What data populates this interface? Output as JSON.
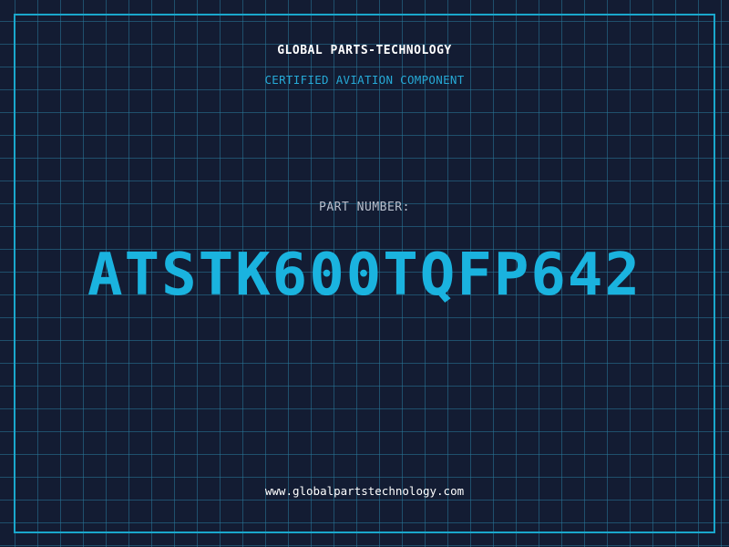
{
  "header": {
    "company": "GLOBAL PARTS-TECHNOLOGY",
    "tagline": "CERTIFIED AVIATION COMPONENT"
  },
  "part": {
    "label": "PART NUMBER:",
    "number": "ATSTK600TQFP642"
  },
  "footer": {
    "website": "www.globalpartstechnology.com"
  },
  "colors": {
    "background": "#131c33",
    "grid": "#28789b",
    "accent": "#1ab3df",
    "text": "#ffffff"
  }
}
